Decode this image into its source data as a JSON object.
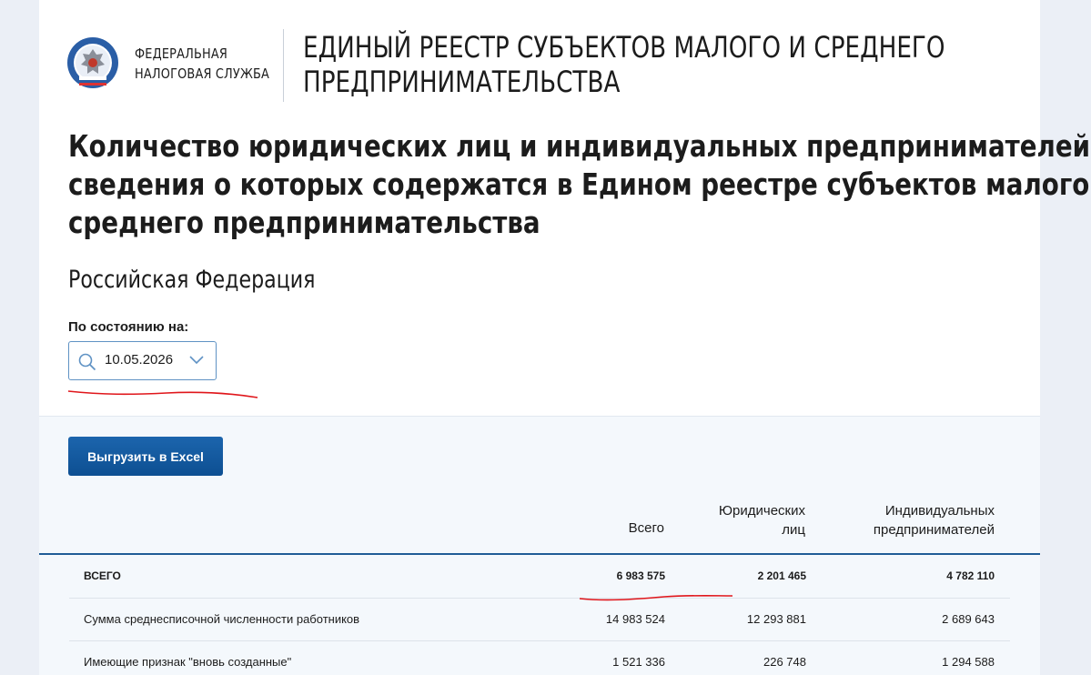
{
  "header": {
    "org_line1": "ФЕДЕРАЛЬНАЯ",
    "org_line2": "НАЛОГОВАЯ СЛУЖБА",
    "registry_line1": "ЕДИНЫЙ РЕЕСТР СУБЪЕКТОВ МАЛОГО И СРЕДНЕГО",
    "registry_line2": "ПРЕДПРИНИМАТЕЛЬСТВА"
  },
  "heading": {
    "line1": "Количество юридических лиц и индивидуальных предпринимателей,",
    "line2": "сведения о которых содержатся в Едином реестре субъектов малого и",
    "line3": "среднего предпринимательства"
  },
  "region": "Российская Федерация",
  "date_filter": {
    "label": "По состоянию на:",
    "value": "10.05.2026"
  },
  "export_button": "Выгрузить в Excel",
  "table": {
    "headers": {
      "total": "Всего",
      "legal_line1": "Юридических",
      "legal_line2": "лиц",
      "ind_line1": "Индивидуальных",
      "ind_line2": "предпринимателей"
    },
    "rows": [
      {
        "label": "ВСЕГО",
        "total": "6 983 575",
        "legal": "2 201 465",
        "ind": "4 782 110"
      },
      {
        "label": "Сумма среднесписочной численности работников",
        "total": "14 983 524",
        "legal": "12 293 881",
        "ind": "2 689 643"
      },
      {
        "label": "Имеющие признак \"вновь созданные\"",
        "total": "1 521 336",
        "legal": "226 748",
        "ind": "1 294 588"
      }
    ]
  },
  "colors": {
    "accent_blue": "#1c65ad",
    "annotation_red": "#e0161b",
    "page_background": "#ebeff6"
  }
}
